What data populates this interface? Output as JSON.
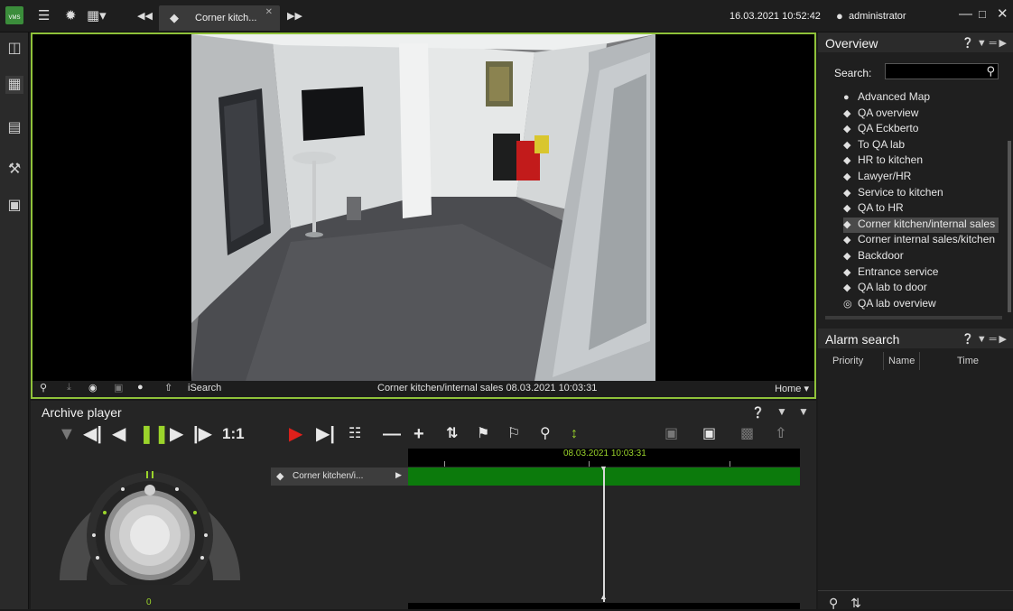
{
  "titlebar": {
    "tab_title": "Corner kitch...",
    "datetime": "16.03.2021 10:52:42",
    "username": "administrator",
    "app_badge": "VMS"
  },
  "video": {
    "caption": "Corner kitchen/internal sales 08.03.2021 10:03:31",
    "isearch_label": "iSearch",
    "home_label": "Home"
  },
  "archive": {
    "title": "Archive player",
    "ratio_label": "1:1",
    "timeline_time": "08.03.2021 10:03:31",
    "track_label": "Corner kitchen/i...",
    "jog_value": "0"
  },
  "overview": {
    "title": "Overview",
    "search_label": "Search:",
    "items": [
      {
        "label": "Advanced Map",
        "icon": "globe-icon"
      },
      {
        "label": "QA overview",
        "icon": "camera-icon"
      },
      {
        "label": "QA Eckberto",
        "icon": "camera-icon"
      },
      {
        "label": "To QA lab",
        "icon": "camera-icon"
      },
      {
        "label": "HR to kitchen",
        "icon": "camera-icon"
      },
      {
        "label": "Lawyer/HR",
        "icon": "camera-icon"
      },
      {
        "label": "Service to kitchen",
        "icon": "camera-icon"
      },
      {
        "label": "QA to HR",
        "icon": "camera-icon"
      },
      {
        "label": "Corner kitchen/internal sales",
        "icon": "camera-icon",
        "selected": true
      },
      {
        "label": "Corner internal sales/kitchen",
        "icon": "camera-icon"
      },
      {
        "label": "Backdoor",
        "icon": "camera-icon"
      },
      {
        "label": "Entrance service",
        "icon": "camera-icon"
      },
      {
        "label": "QA lab to door",
        "icon": "camera-icon"
      },
      {
        "label": "QA lab overview",
        "icon": "dome-camera-icon"
      }
    ]
  },
  "alarm": {
    "title": "Alarm search",
    "columns": [
      "Priority",
      "Name",
      "Time"
    ]
  },
  "colors": {
    "accent_green": "#8fc23a",
    "track_green": "#0c7a0c",
    "pause_green": "#9bd42b",
    "record_red": "#e0201b"
  }
}
